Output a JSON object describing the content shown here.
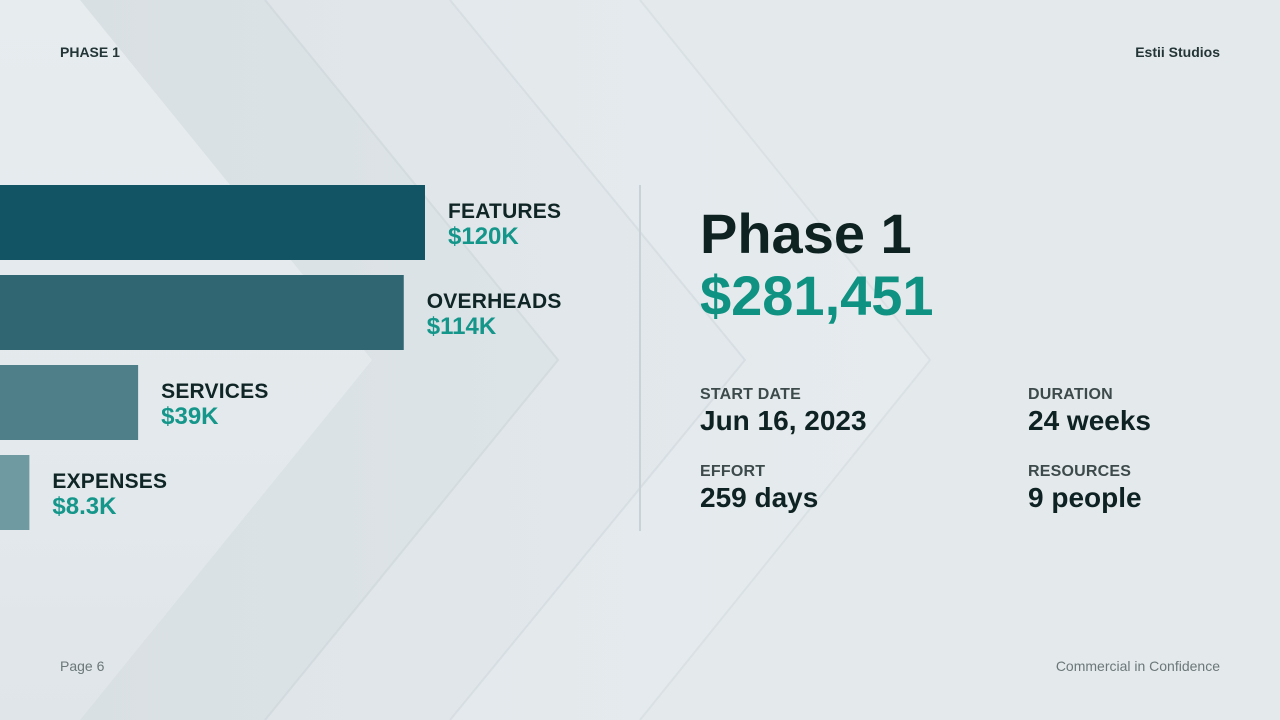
{
  "header": {
    "left": "PHASE 1",
    "right": "Estii Studios"
  },
  "footer": {
    "left": "Page 6",
    "right": "Commercial in Confidence"
  },
  "summary": {
    "title": "Phase 1",
    "total": "$281,451",
    "stats": {
      "start": {
        "label": "START DATE",
        "value": "Jun 16, 2023"
      },
      "duration": {
        "label": "DURATION",
        "value": "24 weeks"
      },
      "effort": {
        "label": "EFFORT",
        "value": "259 days"
      },
      "resources": {
        "label": "RESOURCES",
        "value": "9 people"
      }
    }
  },
  "colors": {
    "accent": "#14968a",
    "bars": [
      "#125463",
      "#2f6672",
      "#4f7f88",
      "#709aa1"
    ]
  },
  "chart_data": {
    "type": "bar",
    "orientation": "horizontal",
    "categories": [
      "FEATURES",
      "OVERHEADS",
      "SERVICES",
      "EXPENSES"
    ],
    "values": [
      120000,
      114000,
      39000,
      8300
    ],
    "value_labels": [
      "$120K",
      "$114K",
      "$39K",
      "$8.3K"
    ]
  }
}
